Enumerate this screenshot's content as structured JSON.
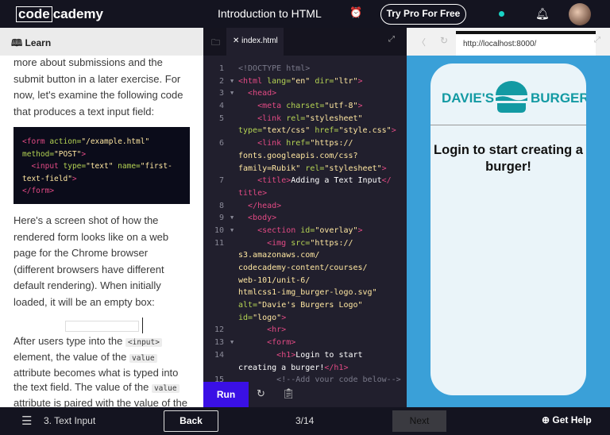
{
  "header": {
    "logo_boxed": "code",
    "logo_rest": "cademy",
    "title": "Introduction to HTML",
    "pro_button": "Try Pro For Free"
  },
  "learn": {
    "tab_label": "Learn",
    "para1": [
      "more about submissions and the",
      "submit button in a later exercise. For",
      "now, let's examine the following code",
      "that produces a text input field:"
    ],
    "code_example": [
      [
        [
          "t",
          "<form "
        ],
        [
          "a",
          "action="
        ],
        [
          "s",
          "\"/example.html\""
        ]
      ],
      [
        [
          "a",
          "method="
        ],
        [
          "s",
          "\"POST\""
        ],
        [
          "t",
          ">"
        ]
      ],
      [
        [
          "p",
          "  "
        ],
        [
          "t",
          "<input "
        ],
        [
          "a",
          "type="
        ],
        [
          "s",
          "\"text\" "
        ],
        [
          "a",
          "name="
        ],
        [
          "s",
          "\"first-"
        ]
      ],
      [
        [
          "s",
          "text-field\""
        ],
        [
          "t",
          ">"
        ]
      ],
      [
        [
          "t",
          "</form>"
        ]
      ]
    ],
    "para2": [
      "Here's a screen shot of how the",
      "rendered form looks like on a web",
      "page for the Chrome browser",
      "(different browsers have different",
      "default rendering). When initially",
      "loaded, it will be an empty box:"
    ],
    "para3": {
      "a": "After users type into the ",
      "code1": "<input>",
      "b": "element, the value of the ",
      "code2": "value",
      "c": "attribute becomes what is typed into",
      "d": "the text field. The value of the ",
      "code3": "value",
      "e": "attribute is paired with the value of the"
    }
  },
  "editor": {
    "tab_name": "index.html",
    "run_label": "Run",
    "lines": [
      {
        "n": "1",
        "f": false,
        "tok": [
          [
            "c",
            "<!DOCTYPE html>"
          ]
        ]
      },
      {
        "n": "2",
        "f": true,
        "tok": [
          [
            "t",
            "<html "
          ],
          [
            "a",
            "lang="
          ],
          [
            "s",
            "\"en\" "
          ],
          [
            "a",
            "dir="
          ],
          [
            "s",
            "\"ltr\""
          ],
          [
            "t",
            ">"
          ]
        ]
      },
      {
        "n": "3",
        "f": true,
        "tok": [
          [
            "p",
            "  "
          ],
          [
            "t",
            "<head>"
          ]
        ]
      },
      {
        "n": "4",
        "f": false,
        "tok": [
          [
            "p",
            "    "
          ],
          [
            "t",
            "<meta "
          ],
          [
            "a",
            "charset="
          ],
          [
            "s",
            "\"utf-8\""
          ],
          [
            "t",
            ">"
          ]
        ]
      },
      {
        "n": "5",
        "f": false,
        "tok": [
          [
            "p",
            "    "
          ],
          [
            "t",
            "<link "
          ],
          [
            "a",
            "rel="
          ],
          [
            "s",
            "\"stylesheet\""
          ]
        ]
      },
      {
        "n": "",
        "f": false,
        "tok": [
          [
            "a",
            "type="
          ],
          [
            "s",
            "\"text/css\" "
          ],
          [
            "a",
            "href="
          ],
          [
            "s",
            "\"style.css\""
          ],
          [
            "t",
            ">"
          ]
        ]
      },
      {
        "n": "6",
        "f": false,
        "tok": [
          [
            "p",
            "    "
          ],
          [
            "t",
            "<link "
          ],
          [
            "a",
            "href="
          ],
          [
            "s",
            "\"https://"
          ]
        ]
      },
      {
        "n": "",
        "f": false,
        "tok": [
          [
            "s",
            "fonts.googleapis.com/css?"
          ]
        ]
      },
      {
        "n": "",
        "f": false,
        "tok": [
          [
            "s",
            "family=Rubik\" "
          ],
          [
            "a",
            "rel="
          ],
          [
            "s",
            "\"stylesheet\""
          ],
          [
            "t",
            ">"
          ]
        ]
      },
      {
        "n": "7",
        "f": false,
        "tok": [
          [
            "p",
            "    "
          ],
          [
            "t",
            "<title>"
          ],
          [
            "p",
            "Adding a Text Input"
          ],
          [
            "t",
            "</"
          ]
        ]
      },
      {
        "n": "",
        "f": false,
        "tok": [
          [
            "t",
            "title>"
          ]
        ]
      },
      {
        "n": "8",
        "f": false,
        "tok": [
          [
            "p",
            "  "
          ],
          [
            "t",
            "</head>"
          ]
        ]
      },
      {
        "n": "9",
        "f": true,
        "tok": [
          [
            "p",
            "  "
          ],
          [
            "t",
            "<body>"
          ]
        ]
      },
      {
        "n": "10",
        "f": true,
        "tok": [
          [
            "p",
            "    "
          ],
          [
            "t",
            "<section "
          ],
          [
            "a",
            "id="
          ],
          [
            "s",
            "\"overlay\""
          ],
          [
            "t",
            ">"
          ]
        ]
      },
      {
        "n": "11",
        "f": false,
        "tok": [
          [
            "p",
            "      "
          ],
          [
            "t",
            "<img "
          ],
          [
            "a",
            "src="
          ],
          [
            "s",
            "\"https://"
          ]
        ]
      },
      {
        "n": "",
        "f": false,
        "tok": [
          [
            "s",
            "s3.amazonaws.com/"
          ]
        ]
      },
      {
        "n": "",
        "f": false,
        "tok": [
          [
            "s",
            "codecademy-content/courses/"
          ]
        ]
      },
      {
        "n": "",
        "f": false,
        "tok": [
          [
            "s",
            "web-101/unit-6/"
          ]
        ]
      },
      {
        "n": "",
        "f": false,
        "tok": [
          [
            "s",
            "htmlcss1-img_burger-logo.svg\""
          ]
        ]
      },
      {
        "n": "",
        "f": false,
        "tok": [
          [
            "a",
            "alt="
          ],
          [
            "s",
            "\"Davie's Burgers Logo\""
          ]
        ]
      },
      {
        "n": "",
        "f": false,
        "tok": [
          [
            "a",
            "id="
          ],
          [
            "s",
            "\"logo\""
          ],
          [
            "t",
            ">"
          ]
        ]
      },
      {
        "n": "12",
        "f": false,
        "tok": [
          [
            "p",
            "      "
          ],
          [
            "t",
            "<hr>"
          ]
        ]
      },
      {
        "n": "13",
        "f": true,
        "tok": [
          [
            "p",
            "      "
          ],
          [
            "t",
            "<form>"
          ]
        ]
      },
      {
        "n": "14",
        "f": false,
        "tok": [
          [
            "p",
            "        "
          ],
          [
            "t",
            "<h1>"
          ],
          [
            "p",
            "Login to start"
          ]
        ]
      },
      {
        "n": "",
        "f": false,
        "tok": [
          [
            "p",
            "creating a burger!"
          ],
          [
            "t",
            "</h1>"
          ]
        ]
      },
      {
        "n": "15",
        "f": false,
        "tok": [
          [
            "p",
            "        "
          ],
          [
            "c",
            "<!--Add your code below-->"
          ]
        ]
      }
    ]
  },
  "preview": {
    "url": "http://localhost:8000/",
    "brand_left": "DAVIE'S",
    "brand_right": "BURGERS",
    "heading": "Login to start creating a burger!"
  },
  "footer": {
    "lesson": "3. Text Input",
    "back": "Back",
    "progress": "3/14",
    "next": "Next",
    "help": "Get Help"
  },
  "colors": {
    "run": "#3a10e5",
    "preview_bg": "#3aa0d8",
    "brand": "#139aa3"
  }
}
